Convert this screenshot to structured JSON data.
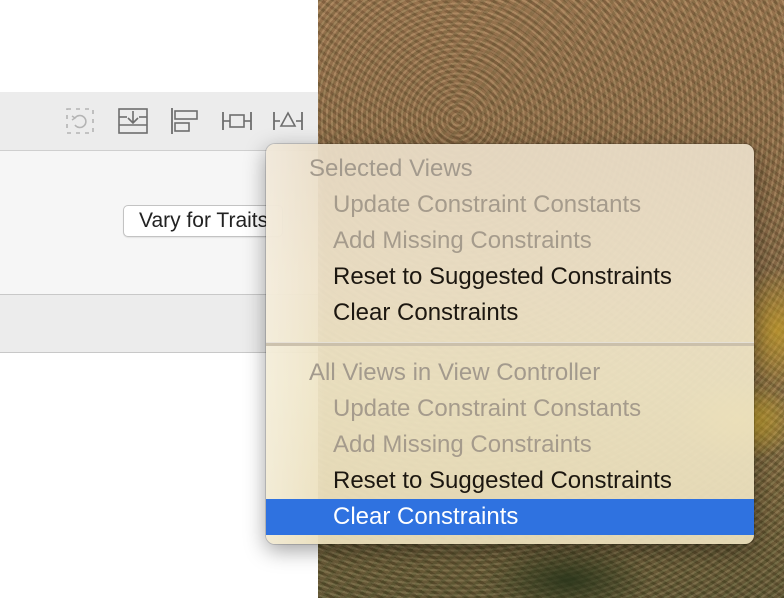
{
  "window": {
    "trait_button_label": "Vary for Traits"
  },
  "toolbar": {
    "icons": [
      "update-frames-icon",
      "embed-in-stack-icon",
      "align-icon",
      "add-constraints-icon",
      "resolve-auto-layout-issues-icon"
    ]
  },
  "menu": {
    "sections": [
      {
        "header": "Selected Views",
        "items": [
          {
            "label": "Update Constraint Constants",
            "enabled": false
          },
          {
            "label": "Add Missing Constraints",
            "enabled": false
          },
          {
            "label": "Reset to Suggested Constraints",
            "enabled": true
          },
          {
            "label": "Clear Constraints",
            "enabled": true
          }
        ]
      },
      {
        "header": "All Views in View Controller",
        "items": [
          {
            "label": "Update Constraint Constants",
            "enabled": false
          },
          {
            "label": "Add Missing Constraints",
            "enabled": false
          },
          {
            "label": "Reset to Suggested Constraints",
            "enabled": true
          },
          {
            "label": "Clear Constraints",
            "enabled": true,
            "highlighted": true
          }
        ]
      }
    ]
  },
  "colors": {
    "highlight": "#2f72e0",
    "disabled_text": "#a59b8c",
    "enabled_text": "#1c1710"
  }
}
